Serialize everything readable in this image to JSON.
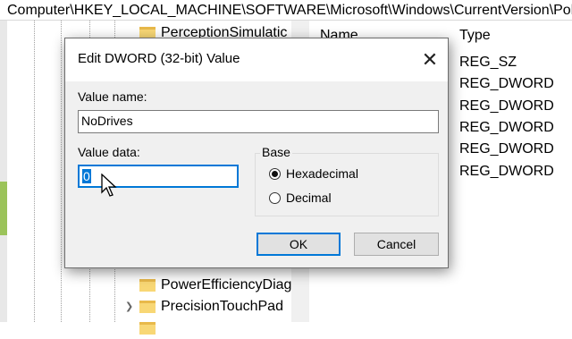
{
  "address_path": "Computer\\HKEY_LOCAL_MACHINE\\SOFTWARE\\Microsoft\\Windows\\CurrentVersion\\Policies",
  "tree": {
    "items": [
      {
        "label": "PerceptionSimulatic"
      },
      {
        "label": "PowerEfficiencyDiag"
      },
      {
        "label": "PrecisionTouchPad"
      }
    ]
  },
  "list": {
    "columns": {
      "name": "Name",
      "type": "Type"
    },
    "types": [
      "REG_SZ",
      "REG_DWORD",
      "REG_DWORD",
      "REG_DWORD",
      "REG_DWORD",
      "REG_DWORD"
    ]
  },
  "dialog": {
    "title": "Edit DWORD (32-bit) Value",
    "close_glyph": "✕",
    "value_name_label": "Value name:",
    "value_name": "NoDrives",
    "value_data_label": "Value data:",
    "value_data": "0",
    "base_label": "Base",
    "base_options": [
      {
        "label": "Hexadecimal",
        "checked": true
      },
      {
        "label": "Decimal",
        "checked": false
      }
    ],
    "ok_label": "OK",
    "cancel_label": "Cancel"
  },
  "colors": {
    "accent": "#0078d7",
    "folder": "#f8d775",
    "dialog_bg": "#f0f0f0"
  }
}
